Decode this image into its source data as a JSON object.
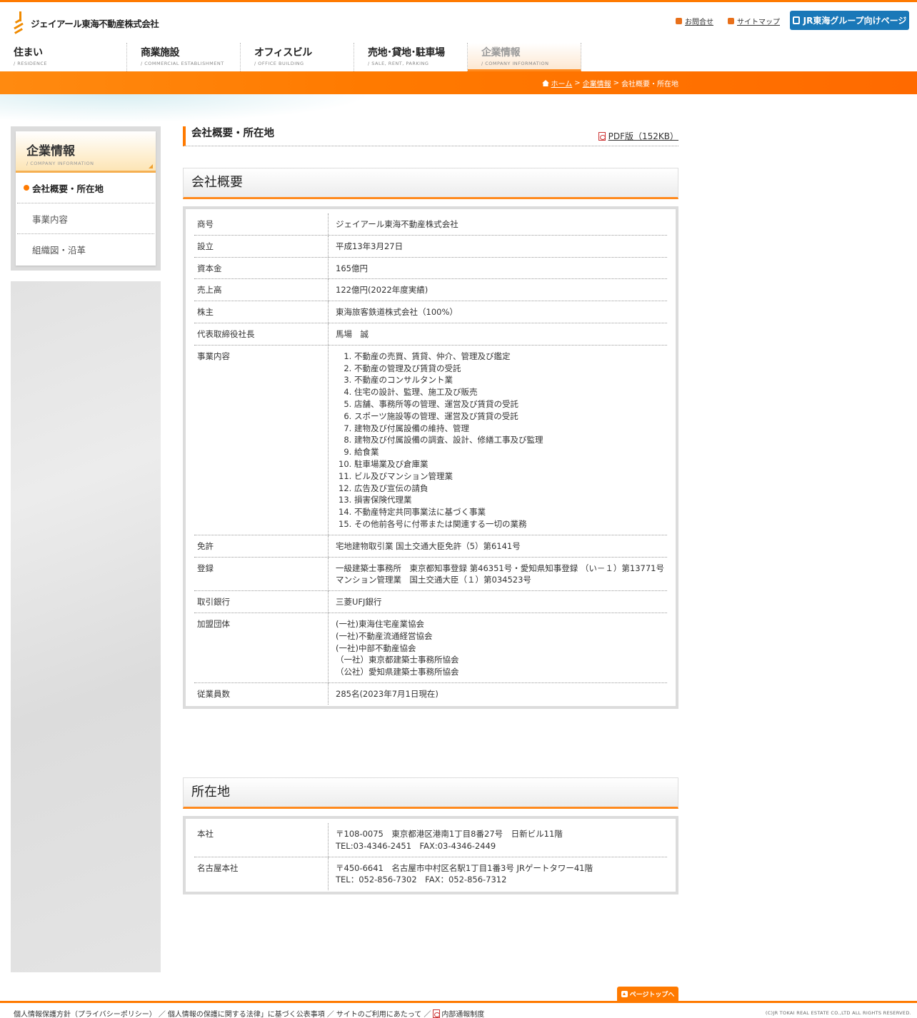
{
  "header": {
    "company_name": "ジェイアール東海不動産株式会社",
    "contact_link": "お問合せ",
    "sitemap_link": "サイトマップ",
    "jr_group_button": "JR東海グループ向けページ"
  },
  "nav": [
    {
      "jp": "住まい",
      "en": "/ RESIDENCE"
    },
    {
      "jp": "商業施設",
      "en": "/ COMMERCIAL ESTABLISHMENT"
    },
    {
      "jp": "オフィスビル",
      "en": "/ OFFICE BUILDING"
    },
    {
      "jp": "売地･貸地･駐車場",
      "en": "/ SALE, RENT, PARKING"
    },
    {
      "jp": "企業情報",
      "en": "/ COMPANY INFORMATION"
    }
  ],
  "breadcrumb": {
    "home": "ホーム",
    "sep": ">",
    "parent": "企業情報",
    "current": "会社概要・所在地"
  },
  "sidebar": {
    "title_jp": "企業情報",
    "title_en": "/ COMPANY INFORMATION",
    "items": [
      "会社概要・所在地",
      "事業内容",
      "組織図・沿革"
    ]
  },
  "page": {
    "title": "会社概要・所在地",
    "pdf_link": "PDF版（152KB）"
  },
  "overview": {
    "heading": "会社概要",
    "rows": {
      "trade_name": {
        "label": "商号",
        "value": "ジェイアール東海不動産株式会社"
      },
      "established": {
        "label": "設立",
        "value": "平成13年3月27日"
      },
      "capital": {
        "label": "資本金",
        "value": "165億円"
      },
      "sales": {
        "label": "売上高",
        "value": "122億円(2022年度実績)"
      },
      "shareholder": {
        "label": "株主",
        "value": "東海旅客鉄道株式会社（100%）"
      },
      "president": {
        "label": "代表取締役社長",
        "value": "馬場　誠"
      },
      "business": {
        "label": "事業内容",
        "items": [
          "不動産の売買、賃貸、仲介、管理及び鑑定",
          "不動産の管理及び賃貸の受託",
          "不動産のコンサルタント業",
          "住宅の設計、監理、施工及び販売",
          "店舗、事務所等の管理、運営及び賃貸の受託",
          "スポーツ施設等の管理、運営及び賃貸の受託",
          "建物及び付属設備の維持、管理",
          "建物及び付属設備の調査、設計、修繕工事及び監理",
          "給食業",
          "駐車場業及び倉庫業",
          "ビル及びマンション管理業",
          "広告及び宣伝の請負",
          "損害保険代理業",
          "不動産特定共同事業法に基づく事業",
          "その他前各号に付帯または関連する一切の業務"
        ]
      },
      "license": {
        "label": "免許",
        "value": "宅地建物取引業 国土交通大臣免許（5）第6141号"
      },
      "registration": {
        "label": "登録",
        "line1": "一級建築士事務所　東京都知事登録 第46351号・愛知県知事登録 （い－１）第13771号",
        "line2": "マンション管理業　国土交通大臣（１）第034523号"
      },
      "bank": {
        "label": "取引銀行",
        "value": "三菱UFJ銀行"
      },
      "associations": {
        "label": "加盟団体",
        "items": [
          "(一社)東海住宅産業協会",
          "(一社)不動産流通経営協会",
          "(一社)中部不動産協会",
          "（一社）東京都建築士事務所協会",
          "（公社）愛知県建築士事務所協会"
        ]
      },
      "employees": {
        "label": "従業員数",
        "value": "285名(2023年7月1日現在)"
      }
    }
  },
  "location": {
    "heading": "所在地",
    "head_office": {
      "label": "本社",
      "line1": "〒108-0075　東京都港区港南1丁目8番27号　日新ビル11階",
      "line2": "TEL:03-4346-2451　FAX:03-4346-2449"
    },
    "nagoya_office": {
      "label": "名古屋本社",
      "line1": "〒450-6641　名古屋市中村区名駅1丁目1番3号 JRゲートタワー41階",
      "line2": "TEL：052-856-7302　FAX：052-856-7312"
    }
  },
  "pagetop": "ページトップへ",
  "footer": {
    "links": [
      "個人情報保護方針（プライバシーポリシー）",
      "個人情報の保護に関する法律」に基づく公表事項",
      "サイトのご利用にあたって",
      "内部通報制度"
    ],
    "separator": "／",
    "copyright": "(C)JR TOKAI REAL ESTATE CO.,LTD ALL RIGHTS RESERVED."
  },
  "colors": {
    "accent": "#ff7a00",
    "jr_blue": "#1a78b8",
    "frame_gray": "#dcdcdc"
  }
}
